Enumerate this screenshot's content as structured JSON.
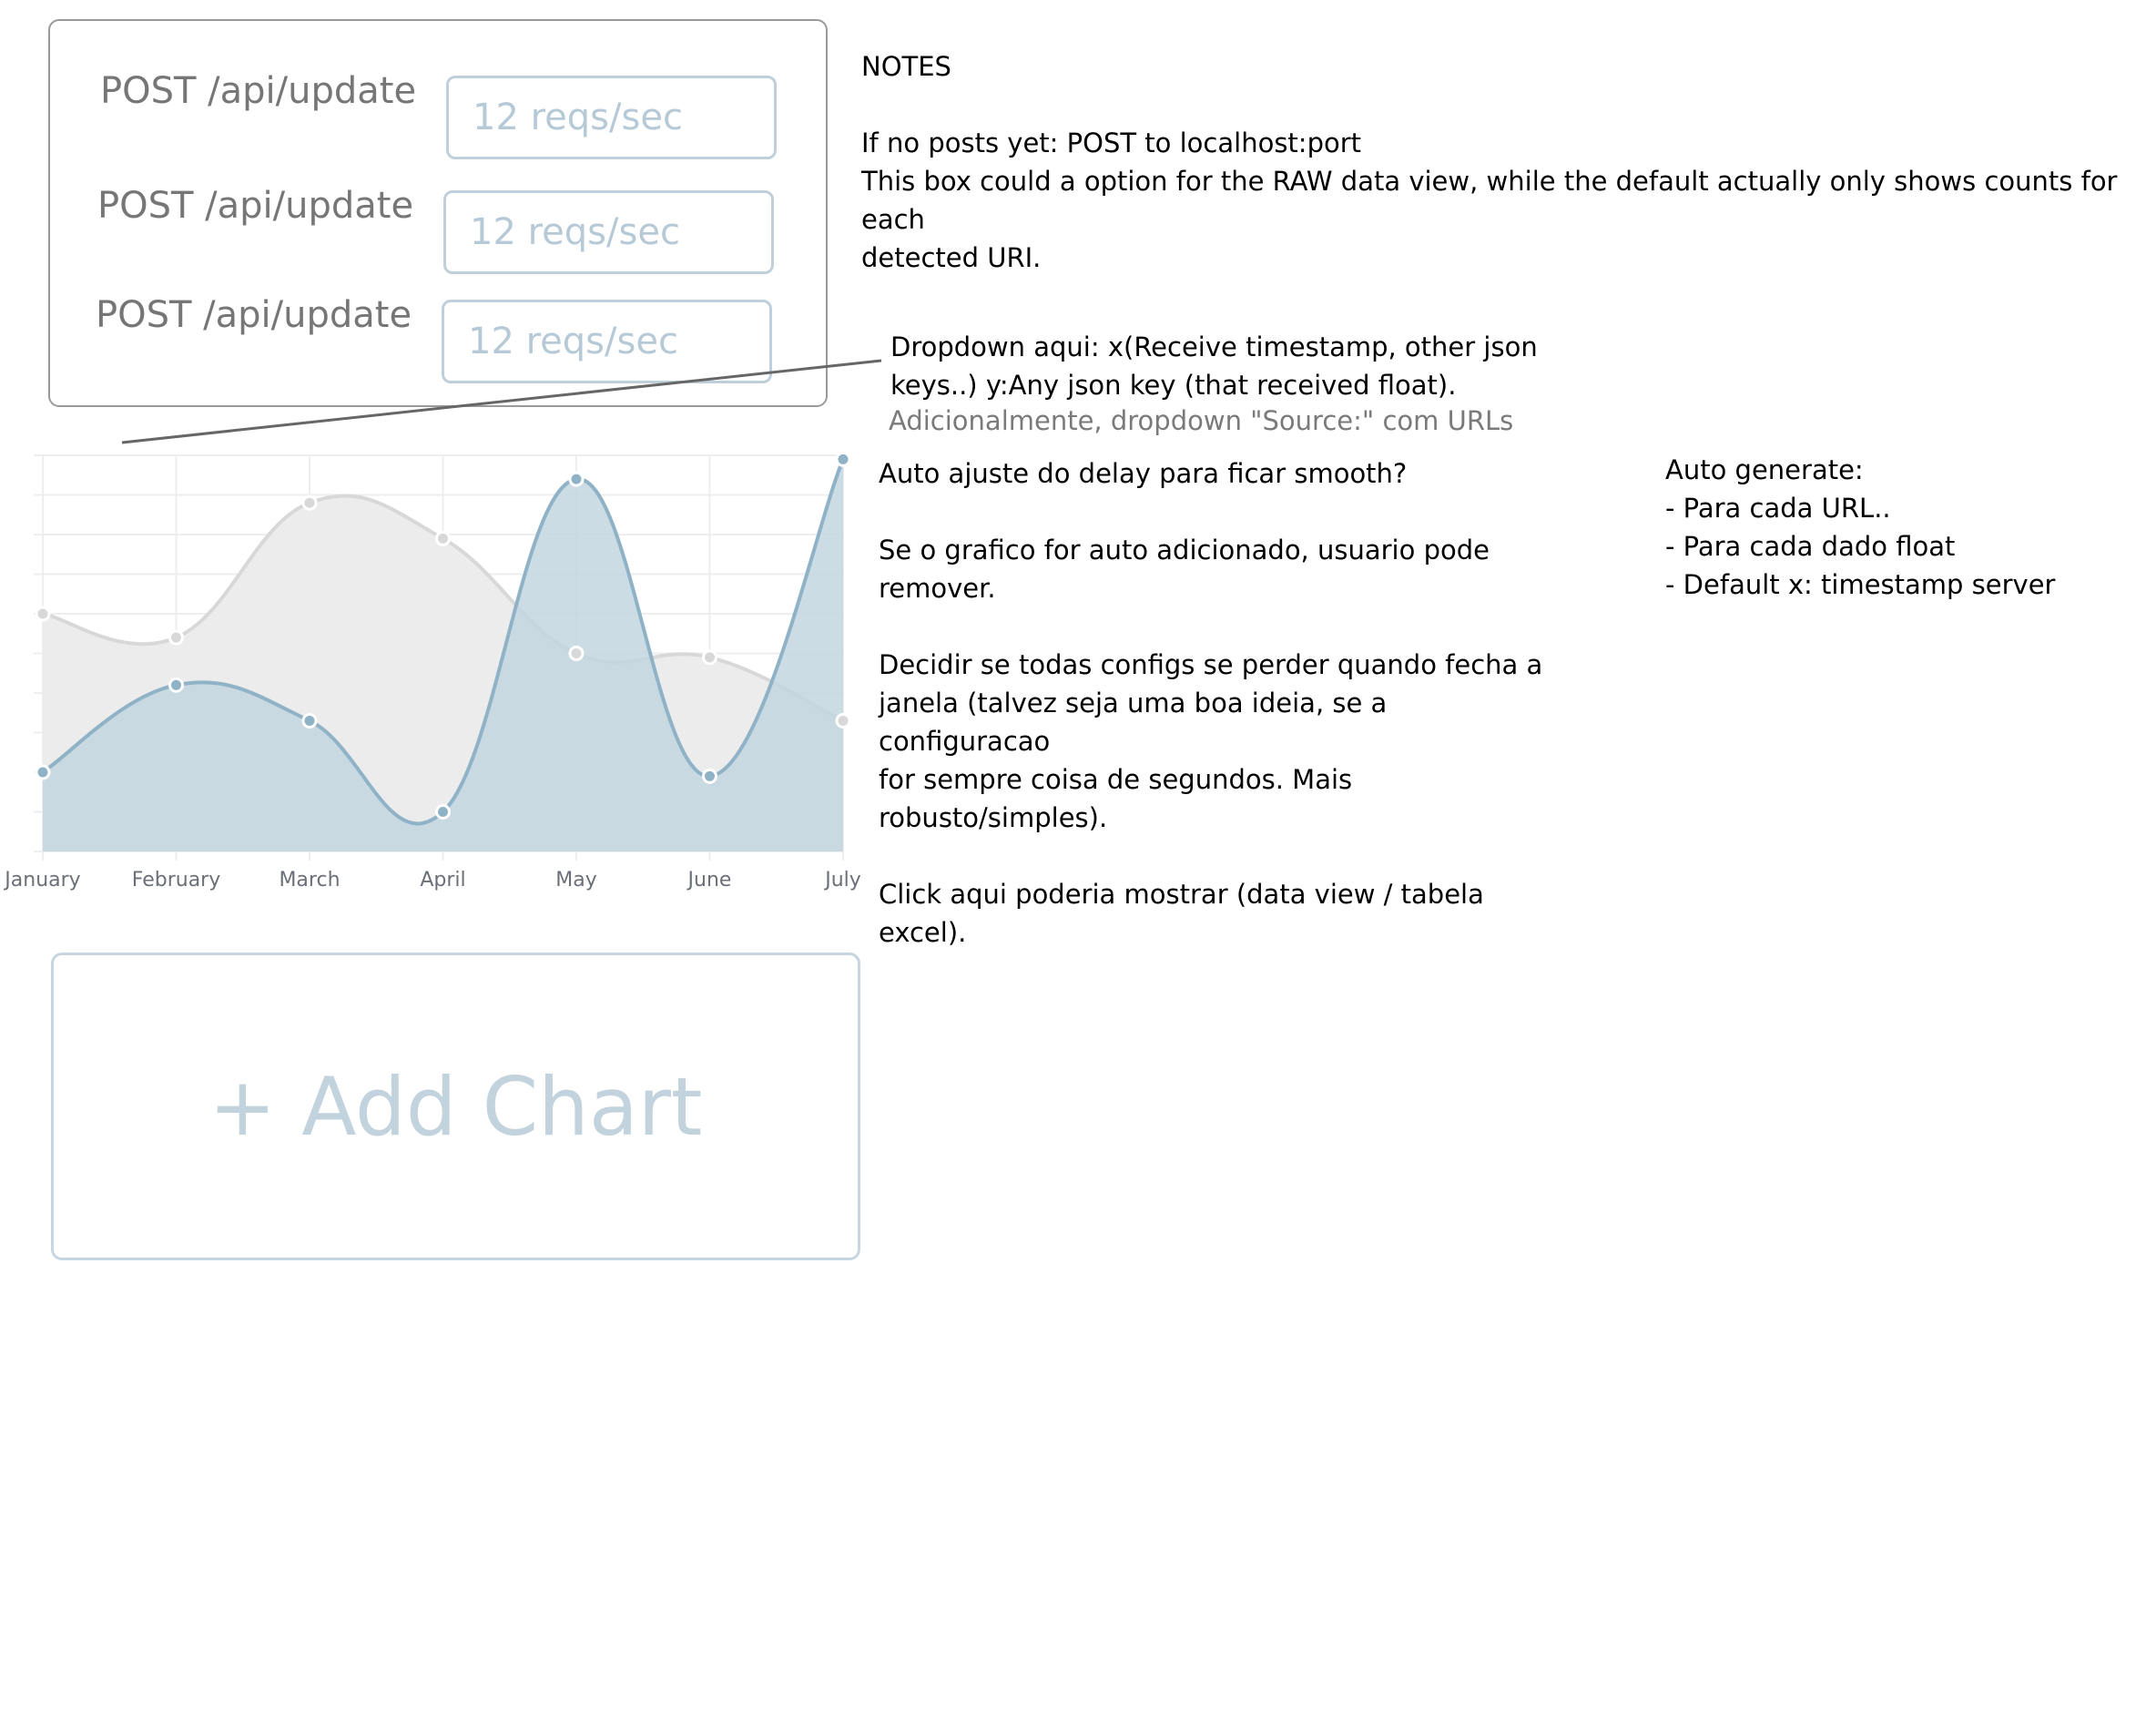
{
  "endpoints": [
    {
      "label": "POST /api/update",
      "rate_placeholder": "12 reqs/sec"
    },
    {
      "label": "POST /api/update",
      "rate_placeholder": "12 reqs/sec"
    },
    {
      "label": "POST /api/update",
      "rate_placeholder": "12 reqs/sec"
    }
  ],
  "notes": {
    "heading": "NOTES",
    "line1": "If no posts yet: POST to localhost:port",
    "line2": "This box could a option for the RAW data view, while the default actually only shows counts for",
    "line3": "each",
    "line4": "detected URI."
  },
  "dropdown_note": {
    "line1": "Dropdown aqui: x(Receive timestamp, other json",
    "line2": "keys..) y:Any json key (that received float).",
    "line3": "Adicionalmente, dropdown \"Source:\" com URLs"
  },
  "chart_notes": {
    "line1": "Auto ajuste do delay para ficar smooth?",
    "line2": "Se o grafico for auto adicionado, usuario pode",
    "line3": "remover.",
    "line4": "Decidir se todas configs se perder quando fecha a",
    "line5": "janela (talvez seja uma boa ideia, se a",
    "line6": "configuracao",
    "line7": "for sempre coisa de segundos. Mais",
    "line8": "robusto/simples).",
    "line9": "Click aqui poderia mostrar (data view / tabela",
    "line10": "excel)."
  },
  "auto_generate": {
    "title": "Auto generate:",
    "item1": "- Para cada URL..",
    "item2": "- Para cada dado float",
    "item3": "- Default x: timestamp server"
  },
  "add_chart": {
    "label": "+ Add Chart"
  },
  "colors": {
    "series_grey_fill": "#ececec",
    "series_grey_stroke": "#d8d8d8",
    "series_blue_fill": "#c3d6e0",
    "series_blue_stroke": "#8fb2c6",
    "grid": "#eeeeee"
  },
  "chart_data": {
    "type": "area",
    "categories": [
      "January",
      "February",
      "March",
      "April",
      "May",
      "June",
      "July"
    ],
    "series": [
      {
        "values": [
          60,
          54,
          88,
          79,
          50,
          49,
          33
        ]
      },
      {
        "values": [
          20,
          42,
          33,
          10,
          94,
          19,
          99
        ]
      }
    ],
    "ylim": [
      0,
      100
    ],
    "grid": true,
    "legend": "none"
  }
}
